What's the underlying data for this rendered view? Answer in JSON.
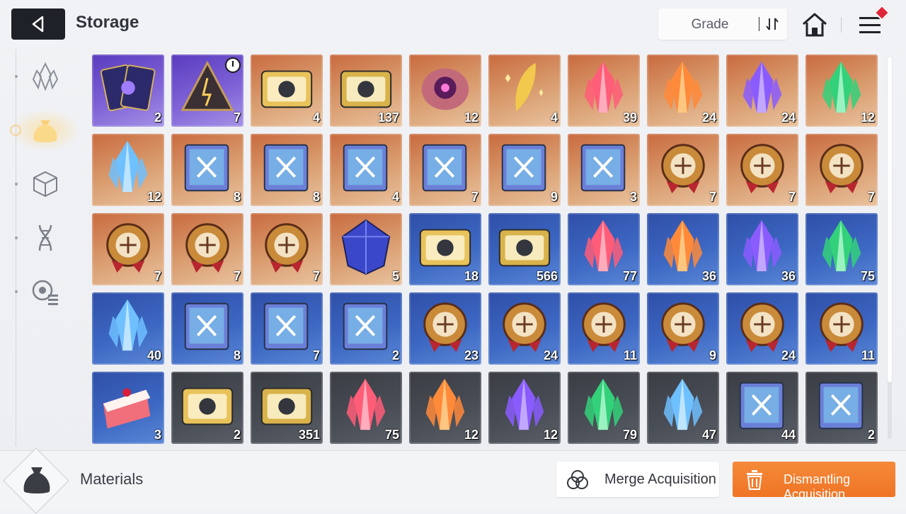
{
  "header": {
    "title": "Storage",
    "sort_label": "Grade"
  },
  "sidebar": {
    "items": [
      {
        "name": "crystal-category-icon",
        "active": false
      },
      {
        "name": "material-bag-category-icon",
        "active": true
      },
      {
        "name": "cube-category-icon",
        "active": false
      },
      {
        "name": "dna-category-icon",
        "active": false
      },
      {
        "name": "list-settings-category-icon",
        "active": false
      }
    ]
  },
  "grid": {
    "items": [
      {
        "icon": "fate-cards-icon",
        "count": "2",
        "bg": "purple"
      },
      {
        "icon": "pyramid-device-icon",
        "count": "7",
        "bg": "purple",
        "timer": true
      },
      {
        "icon": "character-ticket-icon",
        "count": "4",
        "bg": "orange"
      },
      {
        "icon": "star-ticket-icon",
        "count": "137",
        "bg": "orange"
      },
      {
        "icon": "eye-orb-icon",
        "count": "12",
        "bg": "orange"
      },
      {
        "icon": "golden-feather-icon",
        "count": "4",
        "bg": "orange"
      },
      {
        "icon": "red-crystal-icon",
        "count": "39",
        "bg": "orange"
      },
      {
        "icon": "orange-crystal-icon",
        "count": "24",
        "bg": "orange"
      },
      {
        "icon": "purple-crystal-icon",
        "count": "24",
        "bg": "orange"
      },
      {
        "icon": "green-crystal-icon",
        "count": "12",
        "bg": "orange"
      },
      {
        "icon": "blue-crystal-icon",
        "count": "12",
        "bg": "orange"
      },
      {
        "icon": "sword-manual-icon",
        "count": "8",
        "bg": "orange"
      },
      {
        "icon": "shield-manual-icon",
        "count": "8",
        "bg": "orange"
      },
      {
        "icon": "eye-manual-icon",
        "count": "4",
        "bg": "orange"
      },
      {
        "icon": "wing-manual-icon",
        "count": "7",
        "bg": "orange"
      },
      {
        "icon": "lightning-manual-icon",
        "count": "9",
        "bg": "orange"
      },
      {
        "icon": "target-manual-icon",
        "count": "3",
        "bg": "orange"
      },
      {
        "icon": "sword-medal-icon",
        "count": "7",
        "bg": "orange"
      },
      {
        "icon": "shield-medal-icon",
        "count": "7",
        "bg": "orange"
      },
      {
        "icon": "eye-medal-icon",
        "count": "7",
        "bg": "orange"
      },
      {
        "icon": "wing-medal-icon",
        "count": "7",
        "bg": "orange"
      },
      {
        "icon": "lightning-medal-icon",
        "count": "7",
        "bg": "orange"
      },
      {
        "icon": "target-medal-icon",
        "count": "7",
        "bg": "orange"
      },
      {
        "icon": "blue-prism-icon",
        "count": "5",
        "bg": "orange"
      },
      {
        "icon": "character-ticket-icon",
        "count": "18",
        "bg": "blue"
      },
      {
        "icon": "star-ticket-icon",
        "count": "566",
        "bg": "blue"
      },
      {
        "icon": "red-crystal-icon",
        "count": "77",
        "bg": "blue"
      },
      {
        "icon": "orange-crystal-icon",
        "count": "36",
        "bg": "blue"
      },
      {
        "icon": "purple-crystal-icon",
        "count": "36",
        "bg": "blue"
      },
      {
        "icon": "green-crystal-icon",
        "count": "75",
        "bg": "blue"
      },
      {
        "icon": "blue-crystal-icon",
        "count": "40",
        "bg": "blue"
      },
      {
        "icon": "sword-manual-icon",
        "count": "8",
        "bg": "blue"
      },
      {
        "icon": "shield-manual-icon",
        "count": "7",
        "bg": "blue"
      },
      {
        "icon": "wing-manual-icon",
        "count": "2",
        "bg": "blue"
      },
      {
        "icon": "sword-medal-icon",
        "count": "23",
        "bg": "blue"
      },
      {
        "icon": "shield-medal-icon",
        "count": "24",
        "bg": "blue"
      },
      {
        "icon": "eye-medal-icon",
        "count": "11",
        "bg": "blue"
      },
      {
        "icon": "wing-medal-icon",
        "count": "9",
        "bg": "blue"
      },
      {
        "icon": "lightning-medal-icon",
        "count": "24",
        "bg": "blue"
      },
      {
        "icon": "target-medal-icon",
        "count": "11",
        "bg": "blue"
      },
      {
        "icon": "cake-slice-icon",
        "count": "3",
        "bg": "blue"
      },
      {
        "icon": "character-ticket-icon",
        "count": "2",
        "bg": "gray"
      },
      {
        "icon": "star-ticket-icon",
        "count": "351",
        "bg": "gray"
      },
      {
        "icon": "red-crystal-icon",
        "count": "75",
        "bg": "gray"
      },
      {
        "icon": "orange-crystal-icon",
        "count": "12",
        "bg": "gray"
      },
      {
        "icon": "purple-crystal-icon",
        "count": "12",
        "bg": "gray"
      },
      {
        "icon": "green-crystal-icon",
        "count": "79",
        "bg": "gray"
      },
      {
        "icon": "blue-crystal-icon",
        "count": "47",
        "bg": "gray"
      },
      {
        "icon": "sword-manual-icon",
        "count": "44",
        "bg": "gray"
      },
      {
        "icon": "shield-manual-icon",
        "count": "2",
        "bg": "gray"
      }
    ]
  },
  "footer": {
    "category_label": "Materials",
    "merge_label": "Merge Acquisition",
    "dismantle_label": "Dismantling Acquisition"
  },
  "colors": {
    "accent_orange": "#ef7425",
    "badge_red": "#e0263a",
    "grade_purple": "#6a4bcb",
    "grade_orange": "#d8956a",
    "grade_blue": "#3c67c2",
    "grade_gray": "#474b53"
  }
}
